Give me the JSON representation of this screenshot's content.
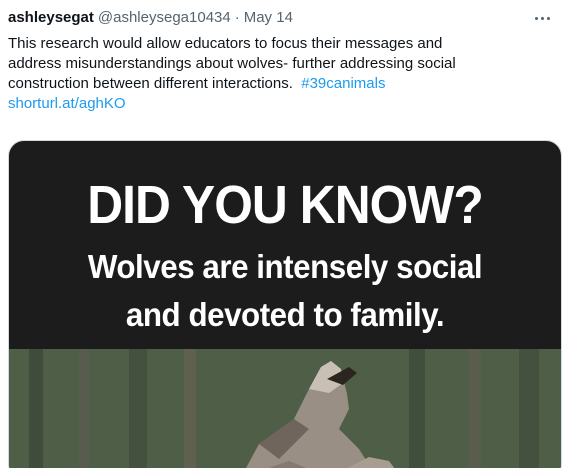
{
  "tweet": {
    "display_name": "ashleysegat",
    "handle": "@ashleysega10434",
    "separator": "·",
    "date": "May 14",
    "text_lines": [
      "This research would allow educators to focus their messages and",
      "address misunderstandings about wolves- further addressing social",
      "construction between different interactions."
    ],
    "hashtag": "#39canimals",
    "link": "shorturl.at/aghKO"
  },
  "image": {
    "headline": "DID YOU KNOW?",
    "subline_1": "Wolves are intensely social",
    "subline_2": "and devoted to family."
  },
  "icons": {
    "more": "more-horizontal-icon"
  },
  "colors": {
    "text": "#0f1419",
    "secondary": "#536471",
    "accent": "#1d9bf0",
    "image_background": "#1c1c1c"
  }
}
